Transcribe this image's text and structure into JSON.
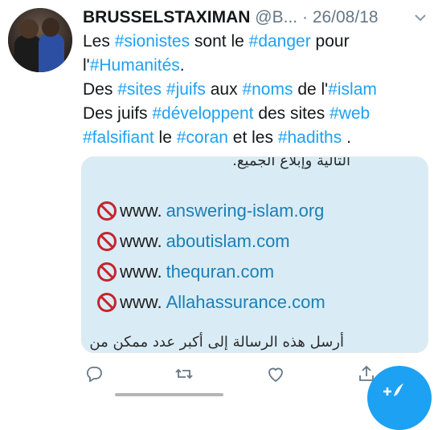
{
  "tweet": {
    "author_name": "BRUSSELSTAXIMAN",
    "author_handle": "@B...",
    "separator": "·",
    "date": "26/08/18",
    "lines": [
      [
        {
          "t": "Les ",
          "tag": false
        },
        {
          "t": "#sionistes",
          "tag": true
        },
        {
          "t": " sont le ",
          "tag": false
        },
        {
          "t": "#danger",
          "tag": true
        },
        {
          "t": " pour",
          "tag": false
        }
      ],
      [
        {
          "t": "l'",
          "tag": false
        },
        {
          "t": "#Humanités",
          "tag": true
        },
        {
          "t": ".",
          "tag": false
        }
      ],
      [
        {
          "t": "Des ",
          "tag": false
        },
        {
          "t": "#sites",
          "tag": true
        },
        {
          "t": " ",
          "tag": false
        },
        {
          "t": "#juifs",
          "tag": true
        },
        {
          "t": " aux ",
          "tag": false
        },
        {
          "t": "#noms",
          "tag": true
        },
        {
          "t": " de l'",
          "tag": false
        },
        {
          "t": "#islam",
          "tag": true
        }
      ],
      [
        {
          "t": "Des juifs ",
          "tag": false
        },
        {
          "t": "#développent",
          "tag": true
        },
        {
          "t": " des sites ",
          "tag": false
        },
        {
          "t": "#web",
          "tag": true
        }
      ],
      [
        {
          "t": "#falsifiant",
          "tag": true
        },
        {
          "t": " le ",
          "tag": false
        },
        {
          "t": "#coran",
          "tag": true
        },
        {
          "t": " et les ",
          "tag": false
        },
        {
          "t": "#hadiths",
          "tag": true
        },
        {
          "t": " .",
          "tag": false
        }
      ]
    ]
  },
  "media": {
    "arabic_top": "التالية وإبلاغ الجميع.",
    "prefix": "www.",
    "sites": [
      "answering-islam.org",
      "aboutislam.com",
      "thequran.com",
      "Allahassurance.com"
    ],
    "arabic_bottom": "أرسل هذه الرسالة إلى أكبر عدد ممكن من"
  },
  "colors": {
    "accent": "#1da1f2",
    "secondary_text": "#657786",
    "media_bg": "#d9ecf6"
  },
  "icons": [
    "reply-icon",
    "retweet-icon",
    "like-icon",
    "share-icon",
    "compose-icon",
    "chevron-down-icon",
    "prohibited-icon"
  ]
}
